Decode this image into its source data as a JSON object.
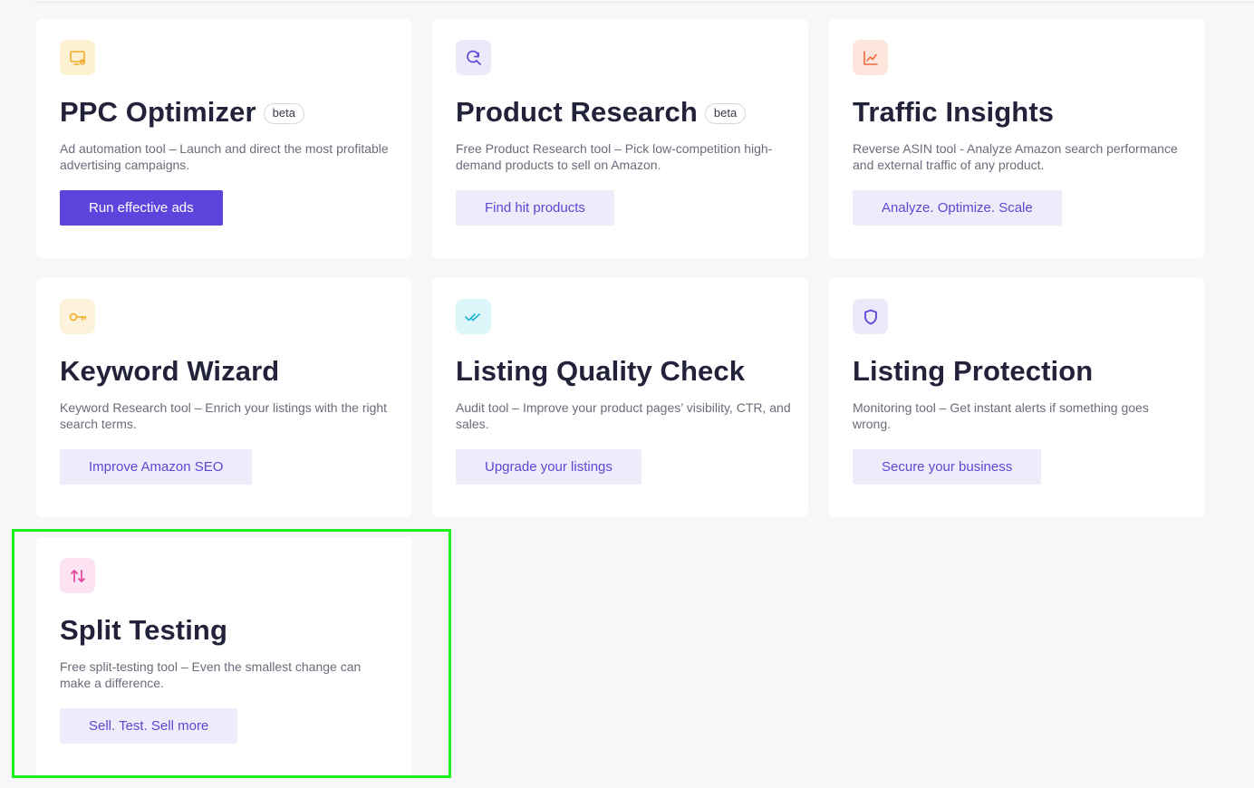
{
  "tools": [
    {
      "title": "PPC Optimizer",
      "badge": "beta",
      "description": "Ad automation tool – Launch and direct the most profitable advertising campaigns.",
      "button": "Run effective ads",
      "icon": "monitor-gear-icon",
      "icon_bg": "#fdf1d2",
      "icon_color": "#f0a928"
    },
    {
      "title": "Product Research",
      "badge": "beta",
      "description": "Free Product Research tool – Pick low-competition high-demand products to sell on Amazon.",
      "button": "Find hit products",
      "icon": "search-refresh-icon",
      "icon_bg": "#ece9fb",
      "icon_color": "#5a47d6"
    },
    {
      "title": "Traffic Insights",
      "description": "Reverse ASIN tool - Analyze Amazon search performance and external traffic of any product.",
      "button": "Analyze. Optimize. Scale",
      "icon": "line-chart-icon",
      "icon_bg": "#fde6dc",
      "icon_color": "#ef6a3d"
    },
    {
      "title": "Keyword Wizard",
      "description": "Keyword Research tool – Enrich your listings with the right search terms.",
      "button": "Improve Amazon SEO",
      "icon": "key-icon",
      "icon_bg": "#fdf3dc",
      "icon_color": "#f1b32d"
    },
    {
      "title": "Listing Quality Check",
      "description": "Audit tool – Improve your product pages’ visibility, CTR, and sales.",
      "button": "Upgrade your listings",
      "icon": "double-check-icon",
      "icon_bg": "#dcf6fa",
      "icon_color": "#25b3d2"
    },
    {
      "title": "Listing Protection",
      "description": "Monitoring tool – Get instant alerts if something goes wrong.",
      "button": "Secure your business",
      "icon": "shield-icon",
      "icon_bg": "#ece9fb",
      "icon_color": "#5a47d6"
    },
    {
      "title": "Split Testing",
      "description": "Free split-testing tool – Even the smallest change can make a difference.",
      "button": "Sell. Test. Sell more",
      "icon": "arrows-up-down-icon",
      "icon_bg": "#fde3f2",
      "icon_color": "#e4429d"
    }
  ],
  "colors": {
    "primary": "#5c44dc",
    "secondary_button_bg": "#eeebfb",
    "secondary_button_text": "#5b48d1",
    "highlight": "#1ef01e"
  }
}
